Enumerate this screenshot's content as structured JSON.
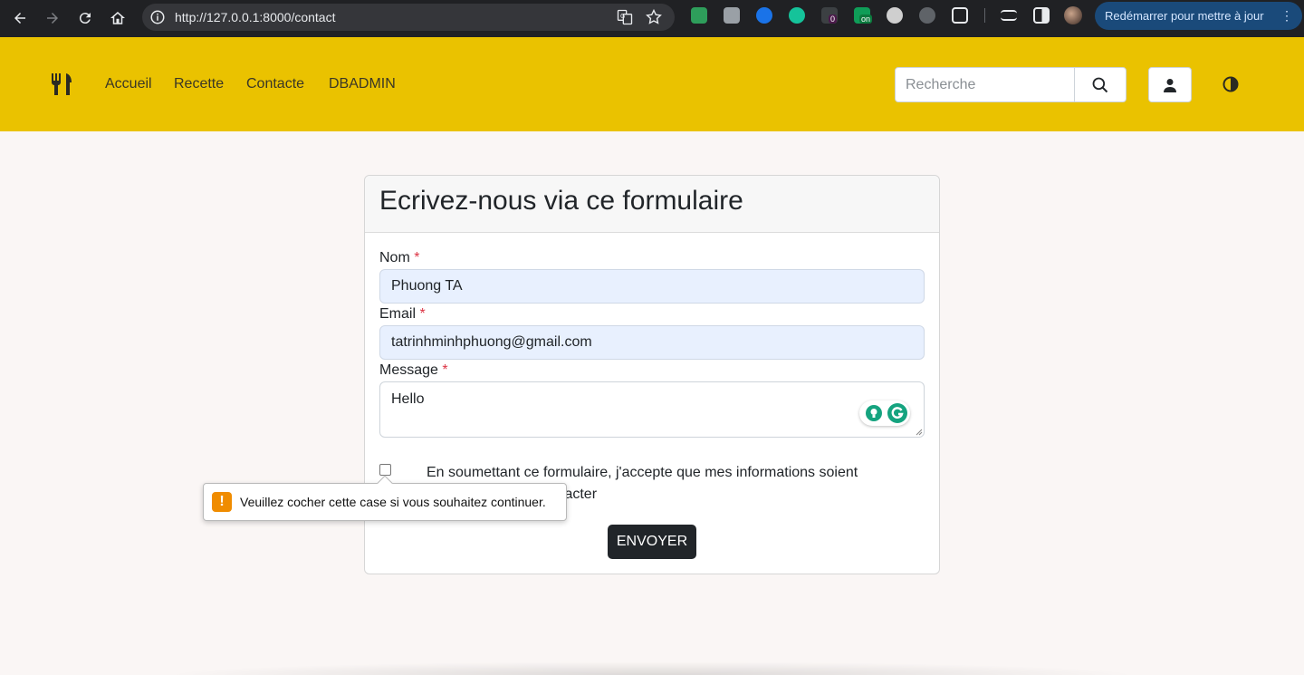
{
  "browser": {
    "url": "http://127.0.0.1:8000/contact",
    "restart_label": "Redémarrer pour mettre à jour",
    "extension_badges": {
      "badge_zero": "0",
      "badge_on": "on"
    }
  },
  "navbar": {
    "links": [
      "Accueil",
      "Recette",
      "Contacte",
      "DBADMIN"
    ],
    "search_placeholder": "Recherche"
  },
  "form": {
    "title": "Ecrivez-nous via ce formulaire",
    "name_label": "Nom",
    "email_label": "Email",
    "message_label": "Message",
    "required_marker": "*",
    "name_value": "Phuong TA",
    "email_value": "tatrinhminhphuong@gmail.com",
    "message_value": "Hello",
    "consent_text_line1": "En soumettant ce formulaire, j'accepte que mes informations soient",
    "consent_text_line2": "tacter",
    "submit_label": "ENVOYER"
  },
  "validation": {
    "icon": "!",
    "message": "Veuillez cocher cette case si vous souhaitez continuer."
  },
  "colors": {
    "navbar_bg": "#eac200",
    "autofill_bg": "#e8f0fe",
    "submit_bg": "#212529",
    "warning": "#f08c00",
    "required": "#dc3545"
  },
  "icons": [
    "back-icon",
    "forward-icon",
    "reload-icon",
    "home-icon",
    "info-icon",
    "translate-icon",
    "star-icon",
    "fork-knife-icon",
    "search-icon",
    "user-icon",
    "contrast-icon",
    "grammarly-icon",
    "warning-icon"
  ]
}
